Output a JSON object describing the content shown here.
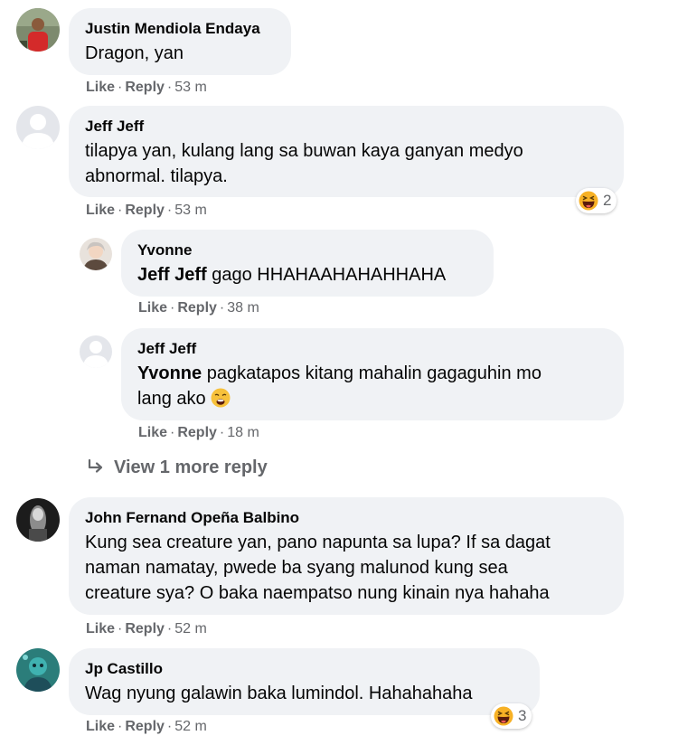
{
  "comments": [
    {
      "author": "Justin Mendiola Endaya",
      "text": "Dragon, yan",
      "like": "Like",
      "reply": "Reply",
      "time": "53 m"
    },
    {
      "author": "Jeff Jeff",
      "text_line1": "tilapya yan, kulang lang sa buwan kaya ganyan medyo",
      "text_line2": "abnormal. tilapya.",
      "like": "Like",
      "reply": "Reply",
      "time": "53 m",
      "reaction_count": "2",
      "reaction_icon": "haha-emoji-icon"
    },
    {
      "author": "Yvonne",
      "mention": "Jeff Jeff",
      "text": " gago HHAHAAHAHAHHAHA",
      "like": "Like",
      "reply": "Reply",
      "time": "38 m"
    },
    {
      "author": "Jeff Jeff",
      "mention": "Yvonne",
      "text_line1": " pagkatapos kitang mahalin gagaguhin mo",
      "text_line2": "lang ako ",
      "inline_emoji": "weary-face-emoji-icon",
      "like": "Like",
      "reply": "Reply",
      "time": "18 m"
    },
    {
      "author": "John Fernand Opeña Balbino",
      "text_line1": "Kung sea creature yan, pano napunta sa lupa? If sa dagat",
      "text_line2": "naman namatay, pwede ba syang malunod kung sea",
      "text_line3": "creature sya? O baka naempatso nung kinain nya hahaha",
      "like": "Like",
      "reply": "Reply",
      "time": "52 m"
    },
    {
      "author": "Jp Castillo",
      "text": "Wag nyung galawin baka lumindol. Hahahahaha",
      "like": "Like",
      "reply": "Reply",
      "time": "52 m",
      "reaction_count": "3",
      "reaction_icon": "haha-emoji-icon"
    }
  ],
  "view_more": "View 1 more reply",
  "separator": "·",
  "colors": {
    "bubble": "#f0f2f5",
    "meta_text": "#65676b",
    "haha_yellow": "#f7b125"
  }
}
